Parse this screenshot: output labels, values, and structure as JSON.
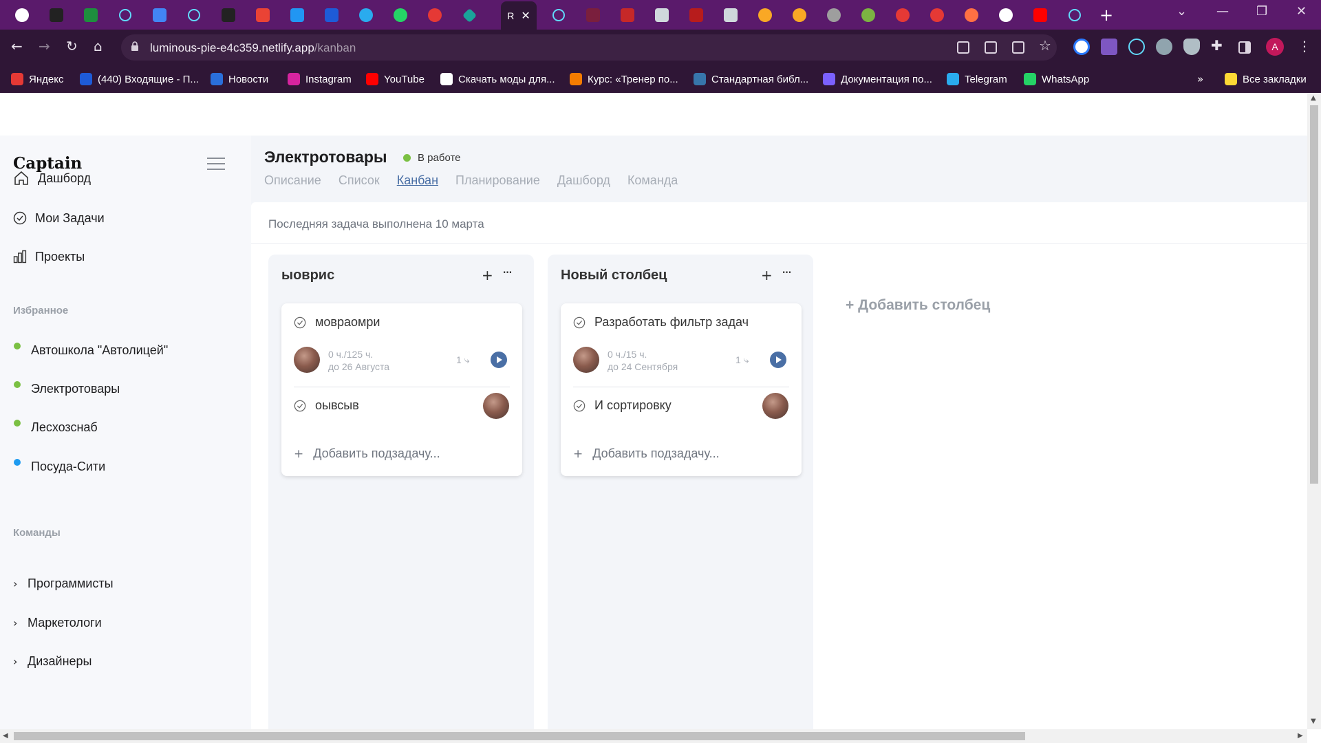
{
  "browser": {
    "url_host": "luminous-pie-e4c359.netlify.app",
    "url_path": "/kanban",
    "active_tab_label": "R",
    "bookmarks": [
      {
        "label": "Яндекс",
        "color": "#e53935"
      },
      {
        "label": "(440) Входящие - П...",
        "color": "#1e5bd8"
      },
      {
        "label": "Новости",
        "color": "#2a6fdb"
      },
      {
        "label": "Instagram",
        "color": "#d6249f"
      },
      {
        "label": "YouTube",
        "color": "#ff0000"
      },
      {
        "label": "Скачать моды для...",
        "color": "#ffffff"
      },
      {
        "label": "Курс: «Тренер по...",
        "color": "#f57c00"
      },
      {
        "label": "Стандартная библ...",
        "color": "#3776ab"
      },
      {
        "label": "Документация по...",
        "color": "#7b61ff"
      },
      {
        "label": "Telegram",
        "color": "#2aabee"
      },
      {
        "label": "WhatsApp",
        "color": "#25d366"
      }
    ],
    "bookmarks_more": "»",
    "all_bookmarks": "Все закладки",
    "profile_initial": "A"
  },
  "sidebar": {
    "logo": "Captain",
    "nav": [
      {
        "label": "Дашборд",
        "icon": "home-icon"
      },
      {
        "label": "Мои Задачи",
        "icon": "check-circle-icon"
      },
      {
        "label": "Проекты",
        "icon": "bar-chart-icon"
      }
    ],
    "favorites_heading": "Избранное",
    "favorites": [
      {
        "label": "Автошкола \"Автолицей\"",
        "color": "#7bc043"
      },
      {
        "label": "Электротовары",
        "color": "#7bc043"
      },
      {
        "label": "Лесхозснаб",
        "color": "#7bc043"
      },
      {
        "label": "Посуда-Сити",
        "color": "#1e9bf0"
      }
    ],
    "teams_heading": "Команды",
    "teams": [
      {
        "label": "Программисты"
      },
      {
        "label": "Маркетологи"
      },
      {
        "label": "Дизайнеры"
      }
    ]
  },
  "project": {
    "title": "Электротовары",
    "status": "В работе",
    "status_color": "#7bc043",
    "tabs": [
      "Описание",
      "Список",
      "Канбан",
      "Планирование",
      "Дашборд",
      "Команда"
    ],
    "active_tab": "Канбан",
    "last_done": "Последняя задача выполнена 10 марта"
  },
  "board": {
    "add_column": "+ Добавить столбец",
    "columns": [
      {
        "title": "ыоврис",
        "task1": {
          "title": "мовраомри",
          "time": "0 ч./125 ч.",
          "due": "до 26 Августа",
          "subtasks": "1"
        },
        "task2": {
          "title": "оывсыв"
        },
        "add_subtask": "Добавить подзадачу..."
      },
      {
        "title": "Новый столбец",
        "task1": {
          "title": "Разработать фильтр задач",
          "time": "0 ч./15 ч.",
          "due": "до 24 Сентября",
          "subtasks": "1"
        },
        "task2": {
          "title": "И сортировку"
        },
        "add_subtask": "Добавить подзадачу..."
      }
    ]
  },
  "colors": {
    "accent": "#4a6fa5",
    "chrome": "#5a1a6b"
  }
}
